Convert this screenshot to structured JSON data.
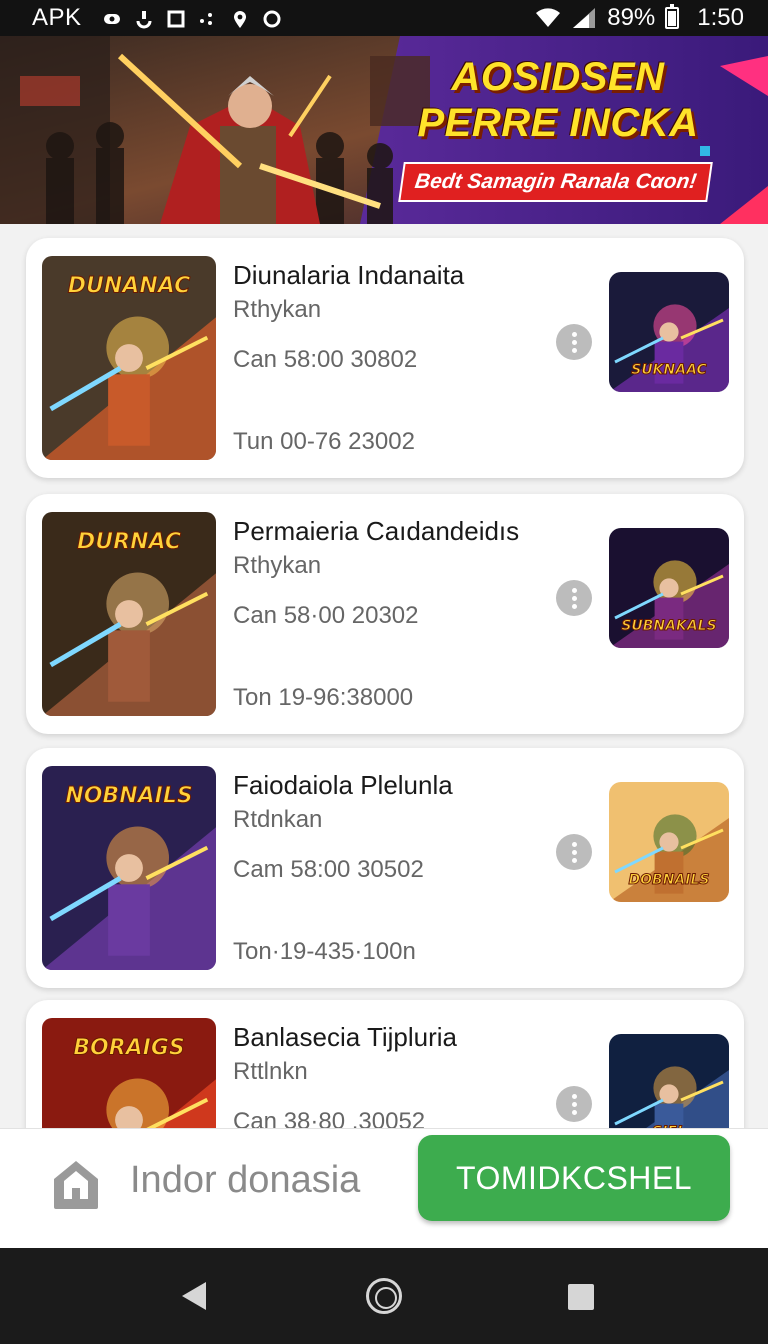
{
  "status_bar": {
    "left_label": "APK",
    "battery": "89%",
    "time": "1:50",
    "icons": [
      "notification-icon",
      "android-icon",
      "square-icon",
      "dots-icon",
      "location-icon",
      "circle-icon",
      "wifi-icon",
      "signal-icon",
      "battery-icon"
    ]
  },
  "banner": {
    "title_line1": "AOSIDSEN",
    "title_line2": "PERRE INCKA",
    "subtitle": "Bedt Samagin Ranala Cαon!"
  },
  "items": [
    {
      "title": "Diunalaria Indanaita",
      "author": "Rthykan",
      "line1": "Can 58:00 30802",
      "line2": "Tun 00-76 23002",
      "thumb_text": "DUNANAC",
      "side_text": "SUKNAAC",
      "thumb_colors": [
        "#4a3a2a",
        "#c85a2a",
        "#f0c050"
      ],
      "side_colors": [
        "#1a1a3a",
        "#6a2aa0",
        "#ff50a0"
      ]
    },
    {
      "title": "Permaieria Caıdandeidıs",
      "author": "Rthykan",
      "line1": "Can 58·00 20302",
      "line2": "Ton 19-96:38000",
      "thumb_text": "DURNAC",
      "side_text": "SUBNAKALS",
      "thumb_colors": [
        "#3a2a1a",
        "#a05a3a",
        "#e0b070"
      ],
      "side_colors": [
        "#1a1030",
        "#7a2a80",
        "#ffd040"
      ]
    },
    {
      "title": "Faiodaiola Plelunla",
      "author": "Rtdnkan",
      "line1": "Cam 58:00 30502",
      "line2": "Ton·19-435·100n",
      "thumb_text": "NOBNAILS",
      "side_text": "DOBNAILS",
      "thumb_colors": [
        "#2a2050",
        "#6a3aa0",
        "#f0a040"
      ],
      "side_colors": [
        "#f0c070",
        "#c07030",
        "#3a6a2a"
      ]
    },
    {
      "title": "Banlasecia Tijpluria",
      "author": "Rttlnkn",
      "line1": "Can 38·80 .30052",
      "line2": "",
      "thumb_text": "BORAIGS",
      "side_text": "SIEL",
      "thumb_colors": [
        "#8a1a10",
        "#e04020",
        "#ffc040"
      ],
      "side_colors": [
        "#102040",
        "#3a5a9a",
        "#e0a040"
      ]
    }
  ],
  "action_bar": {
    "label": "Indor donasia",
    "button_label": "TOMIDKCSHEL",
    "button_color": "#3dac4e"
  }
}
